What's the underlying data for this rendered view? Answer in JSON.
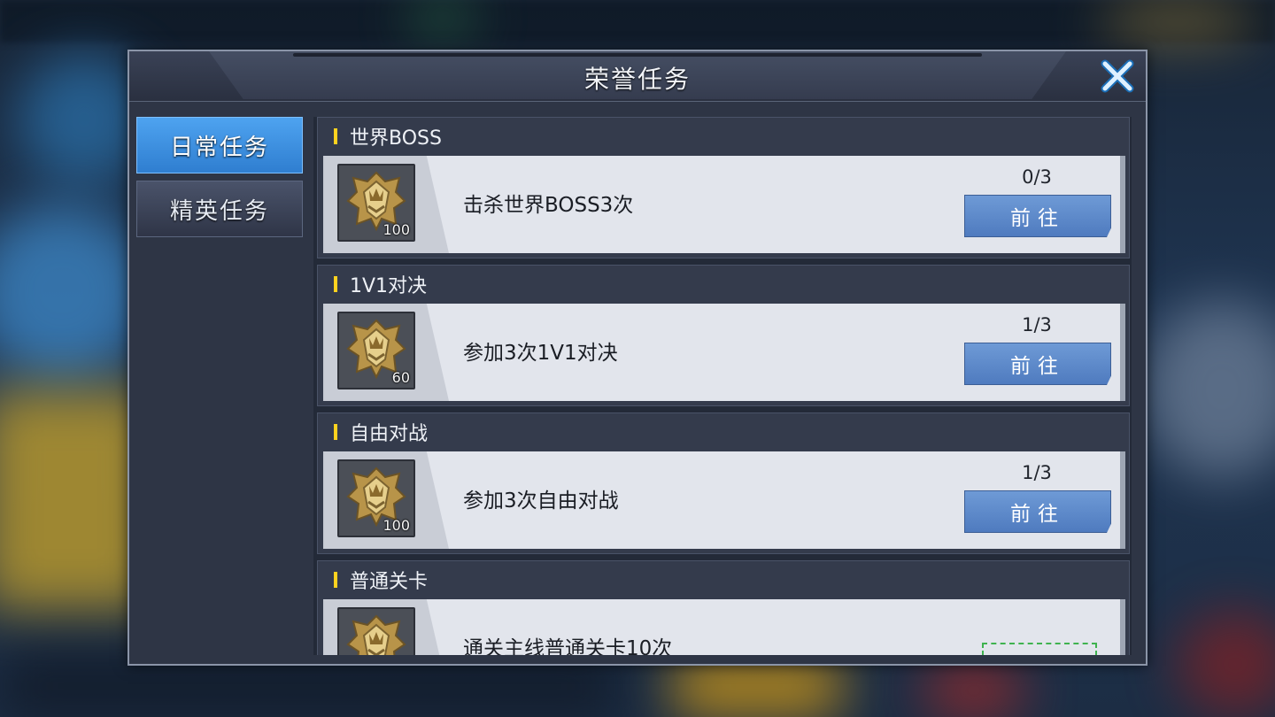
{
  "window": {
    "title": "荣誉任务",
    "close_icon": "close-icon"
  },
  "tabs": [
    {
      "label": "日常任务",
      "active": true
    },
    {
      "label": "精英任务",
      "active": false
    }
  ],
  "tasks": [
    {
      "category": "世界BOSS",
      "description": "击杀世界BOSS3次",
      "reward_icon": "honor-medal-icon",
      "reward_qty": "100",
      "progress": "0/3",
      "button": "前往"
    },
    {
      "category": "1V1对决",
      "description": "参加3次1V1对决",
      "reward_icon": "honor-medal-icon",
      "reward_qty": "60",
      "progress": "1/3",
      "button": "前往"
    },
    {
      "category": "自由对战",
      "description": "参加3次自由对战",
      "reward_icon": "honor-medal-icon",
      "reward_qty": "100",
      "progress": "1/3",
      "button": "前往"
    },
    {
      "category": "普通关卡",
      "description": "通关主线普通关卡10次",
      "reward_icon": "honor-medal-icon",
      "reward_qty": "",
      "progress": "",
      "button": ""
    }
  ],
  "colors": {
    "accent_tab": "#3f91e6",
    "go_button": "#5f8bcb",
    "marker": "#ffd21f"
  }
}
